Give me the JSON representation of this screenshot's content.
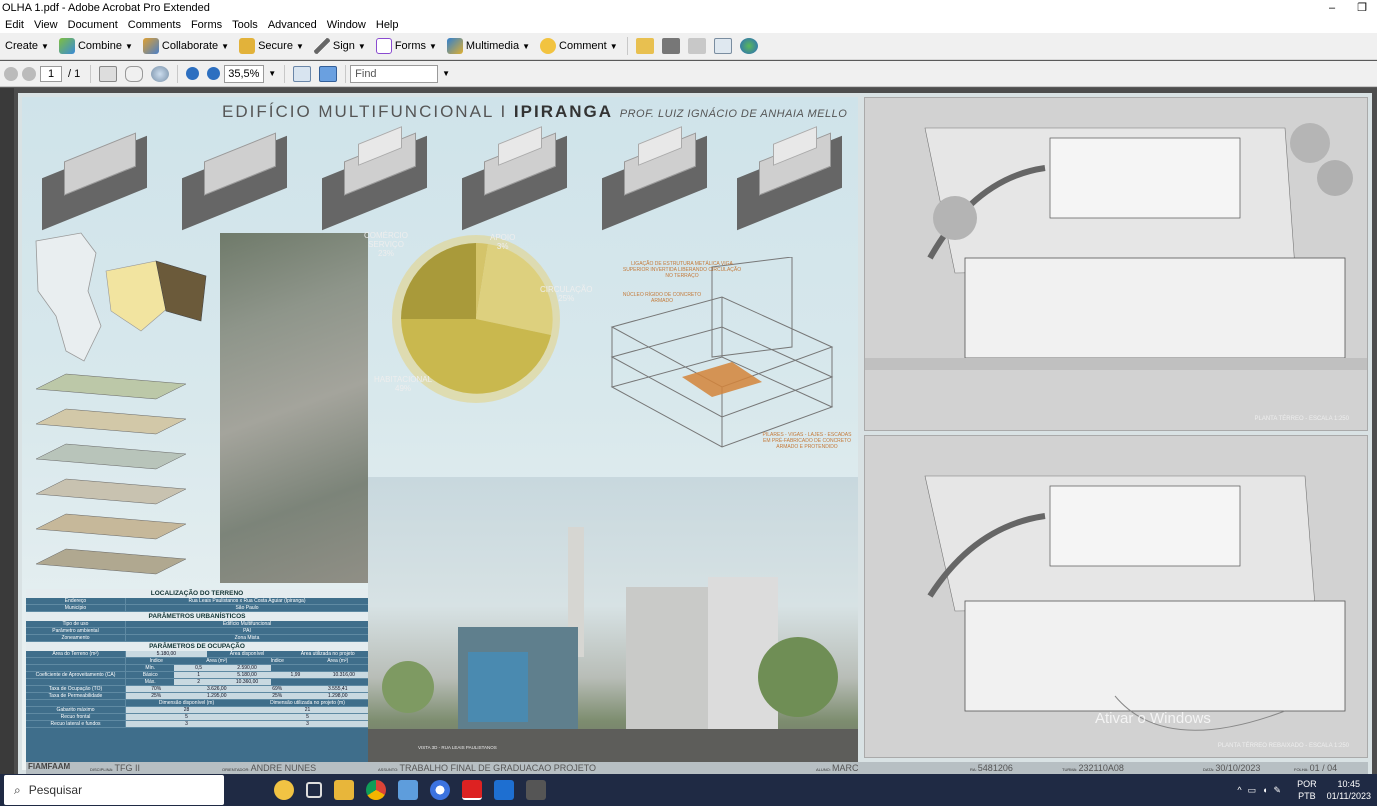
{
  "window": {
    "title": "OLHA 1.pdf - Adobe Acrobat Pro Extended",
    "minimize": "–",
    "restore": "❐"
  },
  "menu": [
    "Edit",
    "View",
    "Document",
    "Comments",
    "Forms",
    "Tools",
    "Advanced",
    "Window",
    "Help"
  ],
  "toolbar1": {
    "create": "Create",
    "combine": "Combine",
    "collaborate": "Collaborate",
    "secure": "Secure",
    "sign": "Sign",
    "forms": "Forms",
    "multimedia": "Multimedia",
    "comment": "Comment"
  },
  "toolbar2": {
    "page": "1",
    "total": "/ 1",
    "zoom": "35,5%",
    "find_placeholder": "Find"
  },
  "poster": {
    "title_pre": "EDIFÍCIO MULTIFUNCIONAL I",
    "title_main": "IPIRANGA",
    "title_prof": "PROF. LUIZ IGNÁCIO DE ANHAIA MELLO",
    "pie": {
      "comercio": "COMÉRCIO",
      "servico": "SERVIÇO",
      "comercio_pct": "23%",
      "apoio": "APOIO",
      "apoio_pct": "3%",
      "circulacao": "CIRCULAÇÃO",
      "circulacao_pct": "25%",
      "habitacional": "HABITACIONAL",
      "habitacional_pct": "49%"
    },
    "struct_note1": "LIGAÇÃO DE ESTRUTURA METÁLICA VIGA SUPERIOR INVERTIDA LIBERANDO CIRCULAÇÃO NO TERRAÇO",
    "struct_note2": "NÚCLEO RÍGIDO DE CONCRETO ARMADO",
    "struct_note3": "PILARES - VIGAS - LAJES - ESCADAS EM PRÉ-FABRICADO DE CONCRETO ARMADO E PROTENDIDO",
    "table": {
      "loc_title": "LOCALIZAÇÃO DO TERRENO",
      "end_k": "Endereço",
      "end_v": "Rua Leais Paulistanos x Rua Costa Aguiar (Ipiranga)",
      "mun_k": "Município",
      "mun_v": "São Paulo",
      "urb_title": "PARÂMETROS URBANÍSTICOS",
      "uso_k": "Tipo de uso",
      "uso_v": "Edifício Multifuncional",
      "amb_k": "Parâmetro ambiental",
      "amb_v": "PAI",
      "zon_k": "Zoneamento",
      "zon_v": "Zona Mista",
      "ocup_title": "PARÂMETROS DE OCUPAÇÃO",
      "area_k": "Área do Terreno (m²)",
      "area_v": "5.180,00",
      "disp": "Área disponível",
      "util": "Área utilizada no projeto",
      "indice": "Índice",
      "area_m2": "Área (m²)",
      "ca_k": "Coeficiente de Aproveitamento (CA)",
      "min": "Mín.",
      "basico": "Básico",
      "max": "Máx.",
      "ca_min": "0,5",
      "ca_bas": "1",
      "ca_max": "2",
      "ca_min_a": "2.590,00",
      "ca_bas_a": "5.180,00",
      "ca_max_a": "10.360,00",
      "ca_used_i": "1,99",
      "ca_used_a": "10.316,00",
      "to_k": "Taxa de Ocupação (TO)",
      "to_i": "70%",
      "to_a": "3.626,00",
      "to_used_i": "69%",
      "to_used_a": "3.555,41",
      "tp_k": "Taxa de Permeabilidade",
      "tp_i": "25%",
      "tp_a": "1.295,00",
      "tp_used_i": "25%",
      "tp_used_a": "1.298,00",
      "dim_disp": "Dimensão disponível (m)",
      "dim_used": "Dimensão utilizada no projeto (m)",
      "gab_k": "Gabarito máximo",
      "gab_v": "28",
      "gab_u": "21",
      "rf_k": "Recuo frontal",
      "rf_v": "5",
      "rf_u": "5",
      "rl_k": "Recuo lateral e fundos",
      "rl_v": "3",
      "rl_u": "3"
    },
    "footer": {
      "brand": "FIAMFAAM",
      "disc_k": "DISCIPLINA:",
      "disc_v": "TFG II",
      "orient_k": "ORIENTADOR:",
      "orient_v": "ANDRE NUNES",
      "assunto_k": "ASSUNTO:",
      "assunto_v": "TRABALHO FINAL  DE GRADUACAO PROJETO",
      "aluno_k": "ALUNO:",
      "aluno_v": "MARCIO YOSHIOKA MACIEL",
      "ra_k": "RA:",
      "ra_v": "5481206",
      "turma_k": "TURMA:",
      "turma_v": "232110A08",
      "data_k": "DATA:",
      "data_v": "30/10/2023",
      "folha_k": "FOLHA:",
      "folha_v": "01 / 04"
    },
    "vista": "VISTA 3D - RUA LEAIS PAULISTANOS",
    "plan1_cap": "PLANTA TÉRREO - ESCALA 1:250",
    "plan2_cap": "PLANTA TÉRREO REBAIXADO - ESCALA 1:250"
  },
  "watermark": "Ativar o Windows",
  "taskbar": {
    "search": "Pesquisar",
    "lang1": "POR",
    "lang2": "PTB",
    "time": "10:45",
    "date": "01/11/2023"
  }
}
